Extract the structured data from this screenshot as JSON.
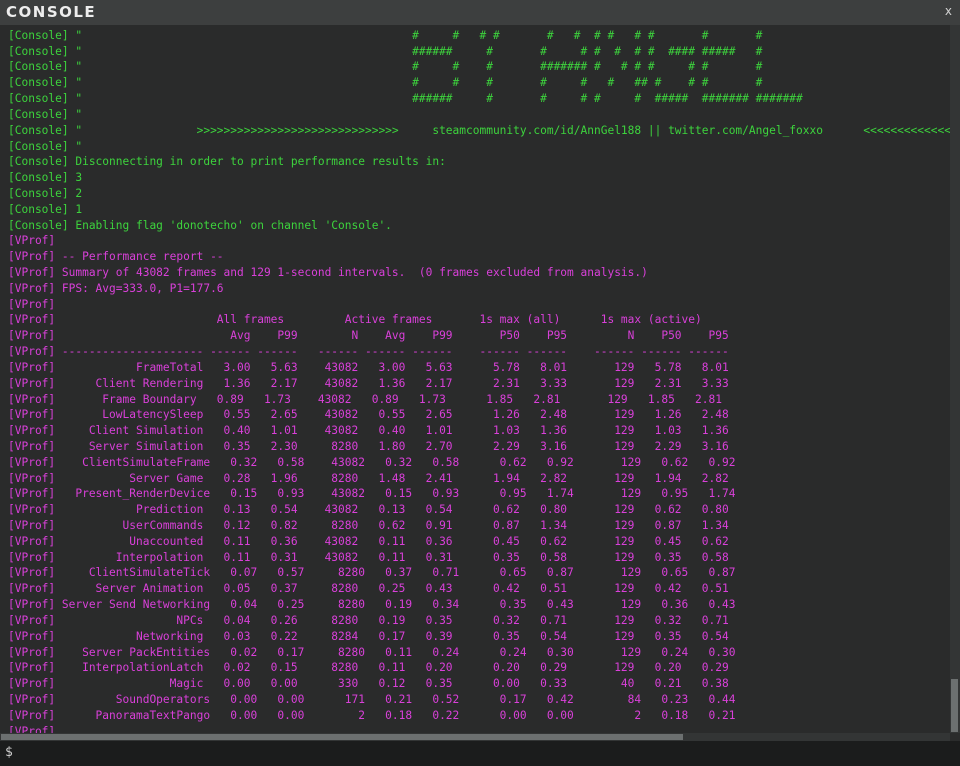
{
  "window": {
    "title": "CONSOLE",
    "close_label": "x"
  },
  "log_lines": [
    {
      "channel": "console",
      "text": "[Console] \""
    },
    {
      "channel": "console",
      "text": "[Console] \"                                                 #     #   # #       #   #  # #   # #       #       #"
    },
    {
      "channel": "console",
      "text": "[Console] \"                                                 ######     #       #     # #  #  # #  #### #####   #"
    },
    {
      "channel": "console",
      "text": "[Console] \"                                                 #     #    #       ####### #   # # #     # #       #"
    },
    {
      "channel": "console",
      "text": "[Console] \"                                                 #     #    #       #     #   #   ## #    # #       #"
    },
    {
      "channel": "console",
      "text": "[Console] \"                                                 ######     #       #     # #     #  #####  ####### #######"
    },
    {
      "channel": "console",
      "text": "[Console] \""
    },
    {
      "channel": "console",
      "text": "[Console] \"                 >>>>>>>>>>>>>>>>>>>>>>>>>>>>>>     steamcommunity.com/id/AnnGel188 || twitter.com/Angel_foxxo      <<<<<<<<<<<<<<<<<<<<<<<<<<<<<<"
    },
    {
      "channel": "console",
      "text": "[Console] \""
    },
    {
      "channel": "console",
      "text": "[Console] Disconnecting in order to print performance results in:"
    },
    {
      "channel": "console",
      "text": "[Console] 3"
    },
    {
      "channel": "console",
      "text": "[Console] 2"
    },
    {
      "channel": "console",
      "text": "[Console] 1"
    },
    {
      "channel": "console",
      "text": "[Console] Enabling flag 'donotecho' on channel 'Console'."
    },
    {
      "channel": "vprof",
      "text": "[VProf]"
    },
    {
      "channel": "vprof",
      "text": "[VProf] -- Performance report --"
    },
    {
      "channel": "vprof",
      "text": "[VProf] Summary of 43082 frames and 129 1-second intervals.  (0 frames excluded from analysis.)"
    },
    {
      "channel": "vprof",
      "text": "[VProf] FPS: Avg=333.0, P1=177.6"
    },
    {
      "channel": "vprof",
      "text": "[VProf]"
    },
    {
      "channel": "vprof",
      "text": "[VProf]                        All frames         Active frames       1s max (all)      1s max (active)"
    },
    {
      "channel": "vprof",
      "text": "[VProf]                          Avg    P99        N    Avg    P99       P50    P95         N    P50    P95"
    },
    {
      "channel": "vprof",
      "text": "[VProf] --------------------- ------ ------   ------ ------ ------    ------ ------    ------ ------ ------"
    },
    {
      "channel": "vprof",
      "text": "[VProf]            FrameTotal   3.00   5.63    43082   3.00   5.63      5.78   8.01       129   5.78   8.01"
    },
    {
      "channel": "vprof",
      "text": "[VProf]      Client Rendering   1.36   2.17    43082   1.36   2.17      2.31   3.33       129   2.31   3.33"
    },
    {
      "channel": "vprof",
      "text": "[VProf]       Frame Boundary   0.89   1.73    43082   0.89   1.73      1.85   2.81       129   1.85   2.81"
    },
    {
      "channel": "vprof",
      "text": "[VProf]       LowLatencySleep   0.55   2.65    43082   0.55   2.65      1.26   2.48       129   1.26   2.48"
    },
    {
      "channel": "vprof",
      "text": "[VProf]     Client Simulation   0.40   1.01    43082   0.40   1.01      1.03   1.36       129   1.03   1.36"
    },
    {
      "channel": "vprof",
      "text": "[VProf]     Server Simulation   0.35   2.30     8280   1.80   2.70      2.29   3.16       129   2.29   3.16"
    },
    {
      "channel": "vprof",
      "text": "[VProf]    ClientSimulateFrame   0.32   0.58    43082   0.32   0.58      0.62   0.92       129   0.62   0.92"
    },
    {
      "channel": "vprof",
      "text": "[VProf]           Server Game   0.28   1.96     8280   1.48   2.41      1.94   2.82       129   1.94   2.82"
    },
    {
      "channel": "vprof",
      "text": "[VProf]   Present_RenderDevice   0.15   0.93    43082   0.15   0.93      0.95   1.74       129   0.95   1.74"
    },
    {
      "channel": "vprof",
      "text": "[VProf]            Prediction   0.13   0.54    43082   0.13   0.54      0.62   0.80       129   0.62   0.80"
    },
    {
      "channel": "vprof",
      "text": "[VProf]          UserCommands   0.12   0.82     8280   0.62   0.91      0.87   1.34       129   0.87   1.34"
    },
    {
      "channel": "vprof",
      "text": "[VProf]           Unaccounted   0.11   0.36    43082   0.11   0.36      0.45   0.62       129   0.45   0.62"
    },
    {
      "channel": "vprof",
      "text": "[VProf]         Interpolation   0.11   0.31    43082   0.11   0.31      0.35   0.58       129   0.35   0.58"
    },
    {
      "channel": "vprof",
      "text": "[VProf]     ClientSimulateTick   0.07   0.57     8280   0.37   0.71      0.65   0.87       129   0.65   0.87"
    },
    {
      "channel": "vprof",
      "text": "[VProf]      Server Animation   0.05   0.37     8280   0.25   0.43      0.42   0.51       129   0.42   0.51"
    },
    {
      "channel": "vprof",
      "text": "[VProf] Server Send Networking   0.04   0.25     8280   0.19   0.34      0.35   0.43       129   0.36   0.43"
    },
    {
      "channel": "vprof",
      "text": "[VProf]                  NPCs   0.04   0.26     8280   0.19   0.35      0.32   0.71       129   0.32   0.71"
    },
    {
      "channel": "vprof",
      "text": "[VProf]            Networking   0.03   0.22     8284   0.17   0.39      0.35   0.54       129   0.35   0.54"
    },
    {
      "channel": "vprof",
      "text": "[VProf]    Server PackEntities   0.02   0.17     8280   0.11   0.24      0.24   0.30       129   0.24   0.30"
    },
    {
      "channel": "vprof",
      "text": "[VProf]    InterpolationLatch   0.02   0.15     8280   0.11   0.20      0.20   0.29       129   0.20   0.29"
    },
    {
      "channel": "vprof",
      "text": "[VProf]                 Magic   0.00   0.00      330   0.12   0.35      0.00   0.33        40   0.21   0.38"
    },
    {
      "channel": "vprof",
      "text": "[VProf]         SoundOperators   0.00   0.00      171   0.21   0.52      0.17   0.42        84   0.23   0.44"
    },
    {
      "channel": "vprof",
      "text": "[VProf]      PanoramaTextPango   0.00   0.00        2   0.18   0.22      0.00   0.00         2   0.18   0.21"
    },
    {
      "channel": "vprof",
      "text": "[VProf]"
    }
  ],
  "input": {
    "prompt": "$",
    "value": "",
    "placeholder": ""
  },
  "colors": {
    "console": "#3dd33d",
    "vprof": "#d940d9",
    "background": "#2a2b2b",
    "titlebar": "#3d3f3f"
  }
}
